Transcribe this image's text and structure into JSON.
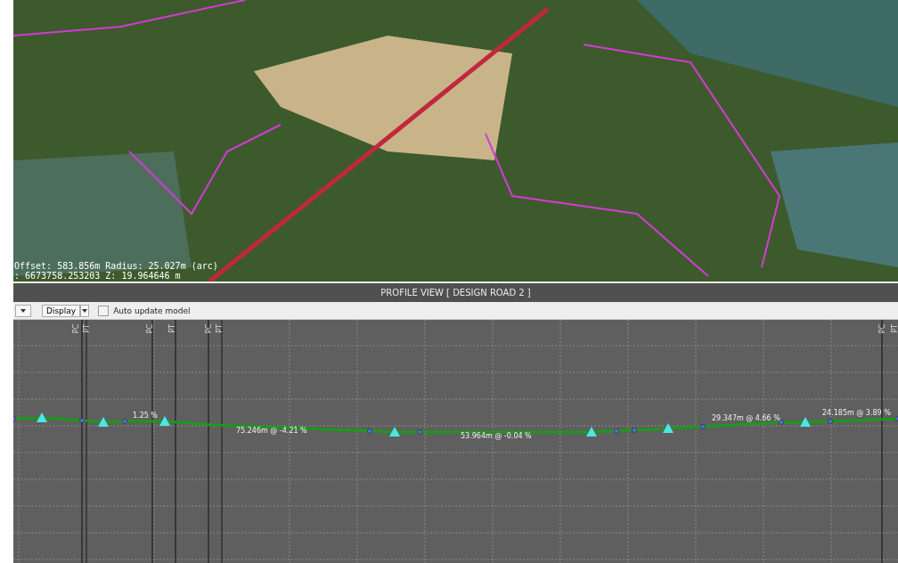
{
  "viewport": {
    "readouts": [
      "Offset: 583.856m Radius: 25.027m (arc)",
      ": 6673758.253203 Z: 19.964646 m"
    ]
  },
  "profile_view": {
    "title": "PROFILE VIEW [ DESIGN ROAD 2 ]",
    "toolbar": {
      "display_button": "Display",
      "auto_update": {
        "label": "Auto update model",
        "checked": false
      }
    },
    "markers": [
      {
        "label": "PC"
      },
      {
        "label": "PT"
      },
      {
        "label": "PC"
      },
      {
        "label": "PT"
      },
      {
        "label": "PC"
      },
      {
        "label": "PT"
      },
      {
        "label": "PC"
      },
      {
        "label": "PT"
      }
    ],
    "grades": [
      "1.25 %",
      "75.246m @ -4.21 %",
      "53.964m @ -0.04 %",
      "29.347m @ 4.66 %",
      "24.185m @ 3.89 %"
    ]
  }
}
